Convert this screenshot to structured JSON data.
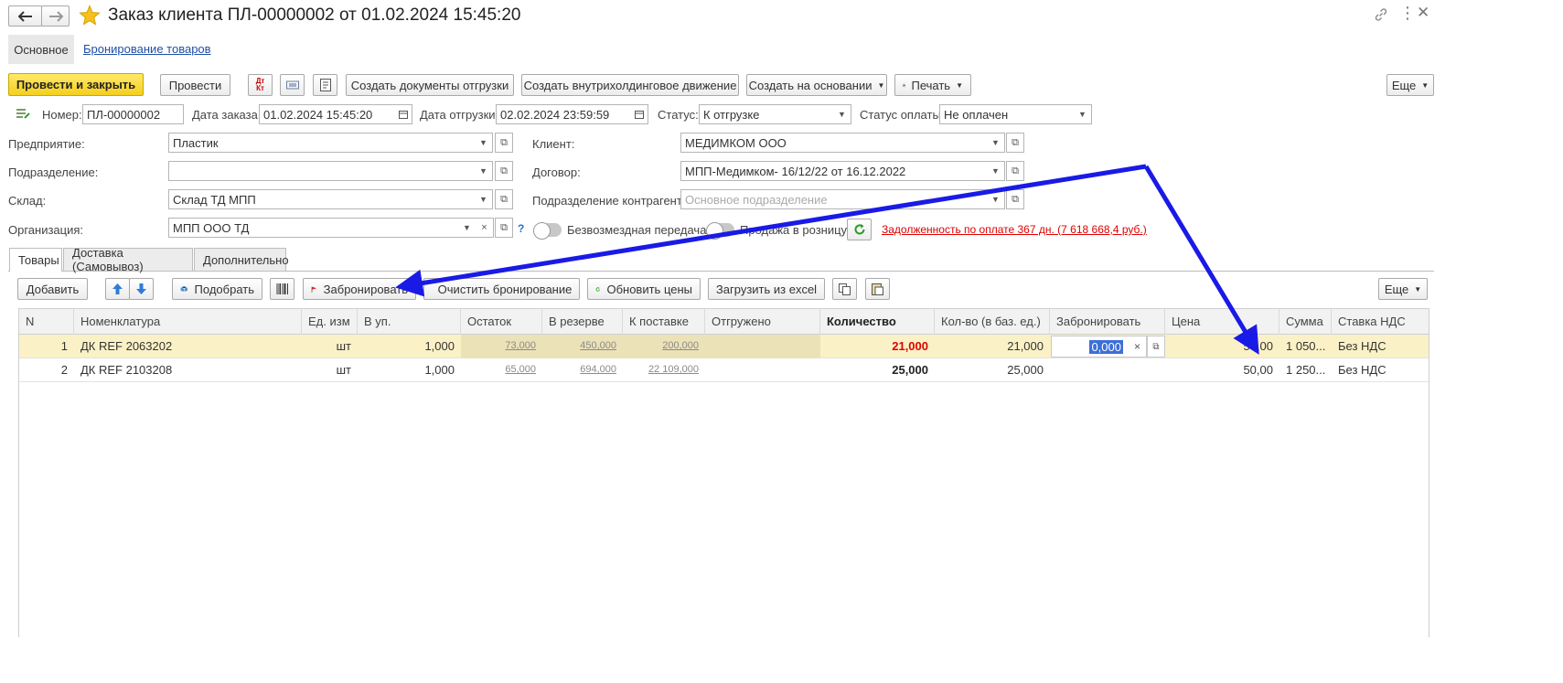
{
  "window": {
    "title": "Заказ клиента ПЛ-00000002 от 01.02.2024 15:45:20",
    "link_icon": "link-icon",
    "menu_icon": "kebab-menu-icon",
    "close_icon": "close-icon"
  },
  "nav_tabs": [
    {
      "label": "Основное"
    },
    {
      "label": "Бронирование товаров"
    }
  ],
  "toolbar": {
    "post_close": "Провести и закрыть",
    "post": "Провести",
    "create_shipment": "Создать документы отгрузки",
    "create_holding": "Создать внутрихолдинговое движение",
    "create_based": "Создать на основании",
    "print": "Печать",
    "more": "Еще"
  },
  "header": {
    "number_label": "Номер:",
    "number": "ПЛ-00000002",
    "order_date_label": "Дата заказа:",
    "order_date": "01.02.2024 15:45:20",
    "ship_date_label": "Дата отгрузки:",
    "ship_date": "02.02.2024 23:59:59",
    "status_label": "Статус:",
    "status": "К отгрузке",
    "pay_status_label": "Статус оплаты:",
    "pay_status": "Не оплачен"
  },
  "form": {
    "enterprise_label": "Предприятие:",
    "enterprise": "Пластик",
    "division_label": "Подразделение:",
    "division": "",
    "warehouse_label": "Склад:",
    "warehouse": "Склад ТД МПП",
    "organization_label": "Организация:",
    "organization": "МПП ООО ТД",
    "client_label": "Клиент:",
    "client": "МЕДИМКОМ ООО",
    "contract_label": "Договор:",
    "contract": "МПП-Медимком- 16/12/22 от 16.12.2022",
    "counterparty_div_label": "Подразделение контрагента:",
    "counterparty_div_placeholder": "Основное подразделение",
    "free_transfer_label": "Безвозмездная передача",
    "retail_label": "Продажа в розницу",
    "debt_text": "Задолженность по оплате 367 дн. (7 618 668,4 руб.)",
    "help": "?"
  },
  "tabs": [
    {
      "label": "Товары"
    },
    {
      "label": "Доставка (Самовывоз)"
    },
    {
      "label": "Дополнительно"
    }
  ],
  "table_toolbar": {
    "add": "Добавить",
    "pick": "Подобрать",
    "reserve": "Забронировать",
    "clear_reserve": "Очистить бронирование",
    "update_prices": "Обновить цены",
    "load_excel": "Загрузить из excel",
    "more": "Еще"
  },
  "table": {
    "columns": [
      "N",
      "Номенклатура",
      "Ед. изм",
      "В уп.",
      "Остаток",
      "В резерве",
      "К поставке",
      "Отгружено",
      "Количество",
      "Кол-во (в баз. ед.)",
      "Забронировать",
      "Цена",
      "Сумма",
      "Ставка НДС"
    ],
    "rows": [
      {
        "n": "1",
        "item": "ДК REF 2063202",
        "unit": "шт",
        "pack": "1,000",
        "stock": "73,000",
        "reserved": "450,000",
        "to_supply": "200,000",
        "shipped": "",
        "qty": "21,000",
        "qty_base": "21,000",
        "reserve": "0,000",
        "price": "50,00",
        "sum": "1 050...",
        "vat": "Без НДС"
      },
      {
        "n": "2",
        "item": "ДК REF 2103208",
        "unit": "шт",
        "pack": "1,000",
        "stock": "65,000",
        "reserved": "694,000",
        "to_supply": "22 109,000",
        "shipped": "",
        "qty": "25,000",
        "qty_base": "25,000",
        "reserve": "",
        "price": "50,00",
        "sum": "1 250...",
        "vat": "Без НДС"
      }
    ]
  },
  "annotation": {
    "color": "#1a1ae6"
  }
}
